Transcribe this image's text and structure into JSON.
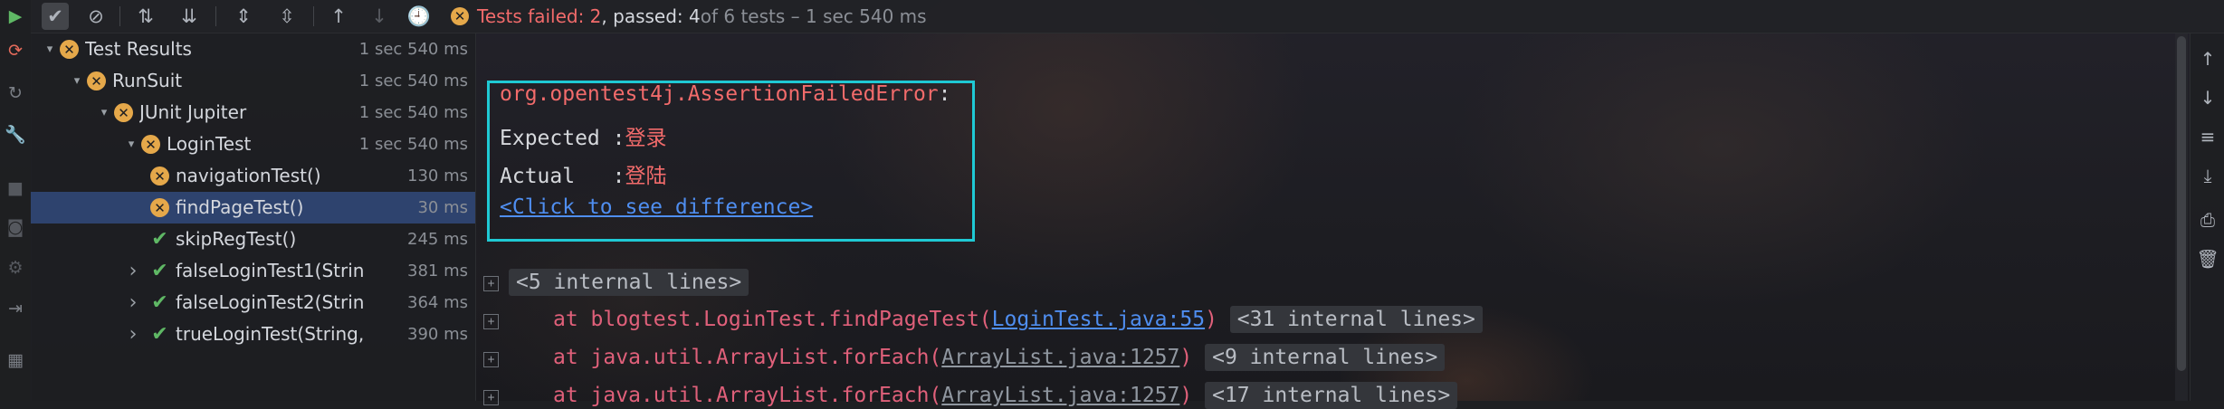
{
  "toolbar": {
    "status": {
      "failed": "Tests failed: 2",
      "passed": ", passed: 4",
      "rest": " of 6 tests – 1 sec 540 ms"
    },
    "more_symbol": "»"
  },
  "tree": {
    "rows": [
      {
        "name": "Test Results",
        "time": "1 sec 540 ms",
        "status": "warn",
        "arrow": "▾"
      },
      {
        "name": "RunSuit",
        "time": "1 sec 540 ms",
        "status": "warn",
        "arrow": "▾"
      },
      {
        "name": "JUnit Jupiter",
        "time": "1 sec 540 ms",
        "status": "warn",
        "arrow": "▾"
      },
      {
        "name": "LoginTest",
        "time": "1 sec 540 ms",
        "status": "warn",
        "arrow": "▾"
      },
      {
        "name": "navigationTest()",
        "time": "130 ms",
        "status": "warn",
        "arrow": ""
      },
      {
        "name": "findPageTest()",
        "time": "30 ms",
        "status": "warn",
        "arrow": ""
      },
      {
        "name": "skipRegTest()",
        "time": "245 ms",
        "status": "ok",
        "arrow": ""
      },
      {
        "name": "falseLoginTest1(Strin",
        "time": "381 ms",
        "status": "ok",
        "arrow": "›"
      },
      {
        "name": "falseLoginTest2(Strin",
        "time": "364 ms",
        "status": "ok",
        "arrow": "›"
      },
      {
        "name": "trueLoginTest(String,",
        "time": "390 ms",
        "status": "ok",
        "arrow": "›"
      }
    ]
  },
  "console": {
    "exception": "org.opentest4j.AssertionFailedError",
    "exception_colon": ":",
    "expected_label": "Expected :",
    "expected_value": "登录",
    "actual_label": "Actual   :",
    "actual_value": "登陆",
    "diff_link": "<Click to see difference>",
    "internal_5": "<5 internal lines>",
    "trace": [
      {
        "prefix": "at blogtest.LoginTest.findPageTest(",
        "loc": "LoginTest.java:55",
        "suffix": ")",
        "internal": "<31 internal lines>"
      },
      {
        "prefix": "at java.util.ArrayList.forEach(",
        "loc": "ArrayList.java:1257",
        "suffix": ")",
        "internal": "<9 internal lines>"
      },
      {
        "prefix": "at java.util.ArrayList.forEach(",
        "loc": "ArrayList.java:1257",
        "suffix": ")",
        "internal": "<17 internal lines>"
      }
    ]
  }
}
